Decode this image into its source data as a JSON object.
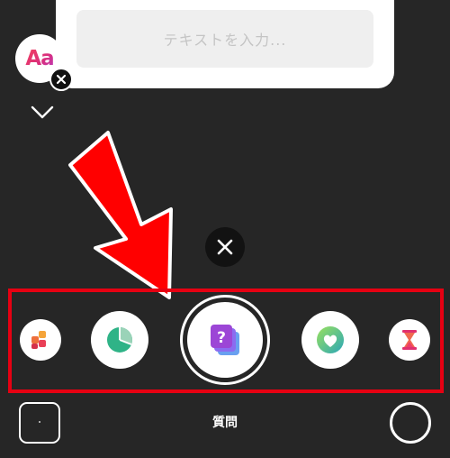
{
  "question_card": {
    "placeholder": "テキストを入力..."
  },
  "font_button": {
    "label": "Aa"
  },
  "bottom_bar": {
    "mode_label": "質問"
  },
  "stickers": [
    "photo-sticker",
    "poll-sticker",
    "question-sticker",
    "emoji-slider-sticker",
    "countdown-sticker"
  ],
  "colors": {
    "highlight": "#e60012",
    "arrow": "#ff0000",
    "background": "#262626"
  }
}
